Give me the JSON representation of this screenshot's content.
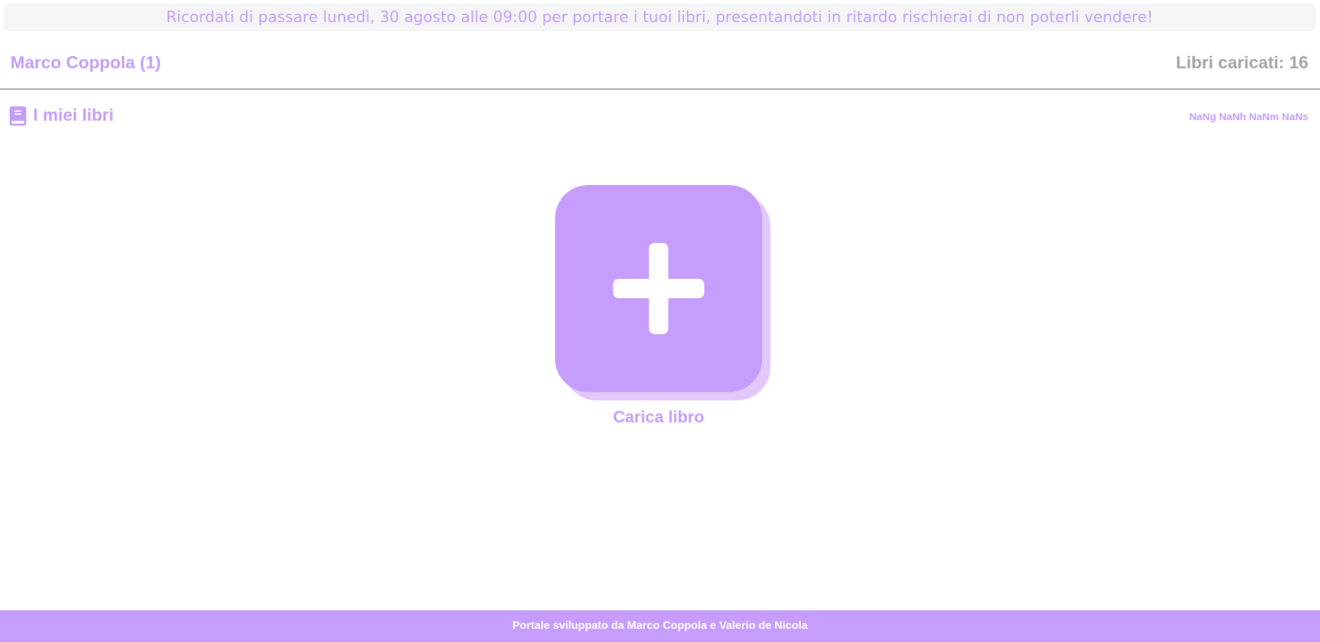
{
  "notice": {
    "text": "Ricordati di passare lunedì, 30 agosto alle 09:00 per portare i tuoi libri, presentandoti in ritardo rischierai di non poterli vendere!"
  },
  "header": {
    "user_name": "Marco Coppola (1)",
    "books_count": "Libri caricati: 16"
  },
  "section": {
    "title": "I miei libri",
    "icon": "book-icon",
    "countdown": "NaNg NaNh NaNm NaNs"
  },
  "upload": {
    "icon": "plus-icon",
    "label": "Carica libro"
  },
  "footer": {
    "text": "Portale sviluppato da Marco Coppola e Valerio de Nicola"
  },
  "colors": {
    "accent": "#c49cfb",
    "accent_light": "#e2c8fd",
    "muted": "#a3a3a3",
    "notice_bg": "#f5f5f5"
  }
}
